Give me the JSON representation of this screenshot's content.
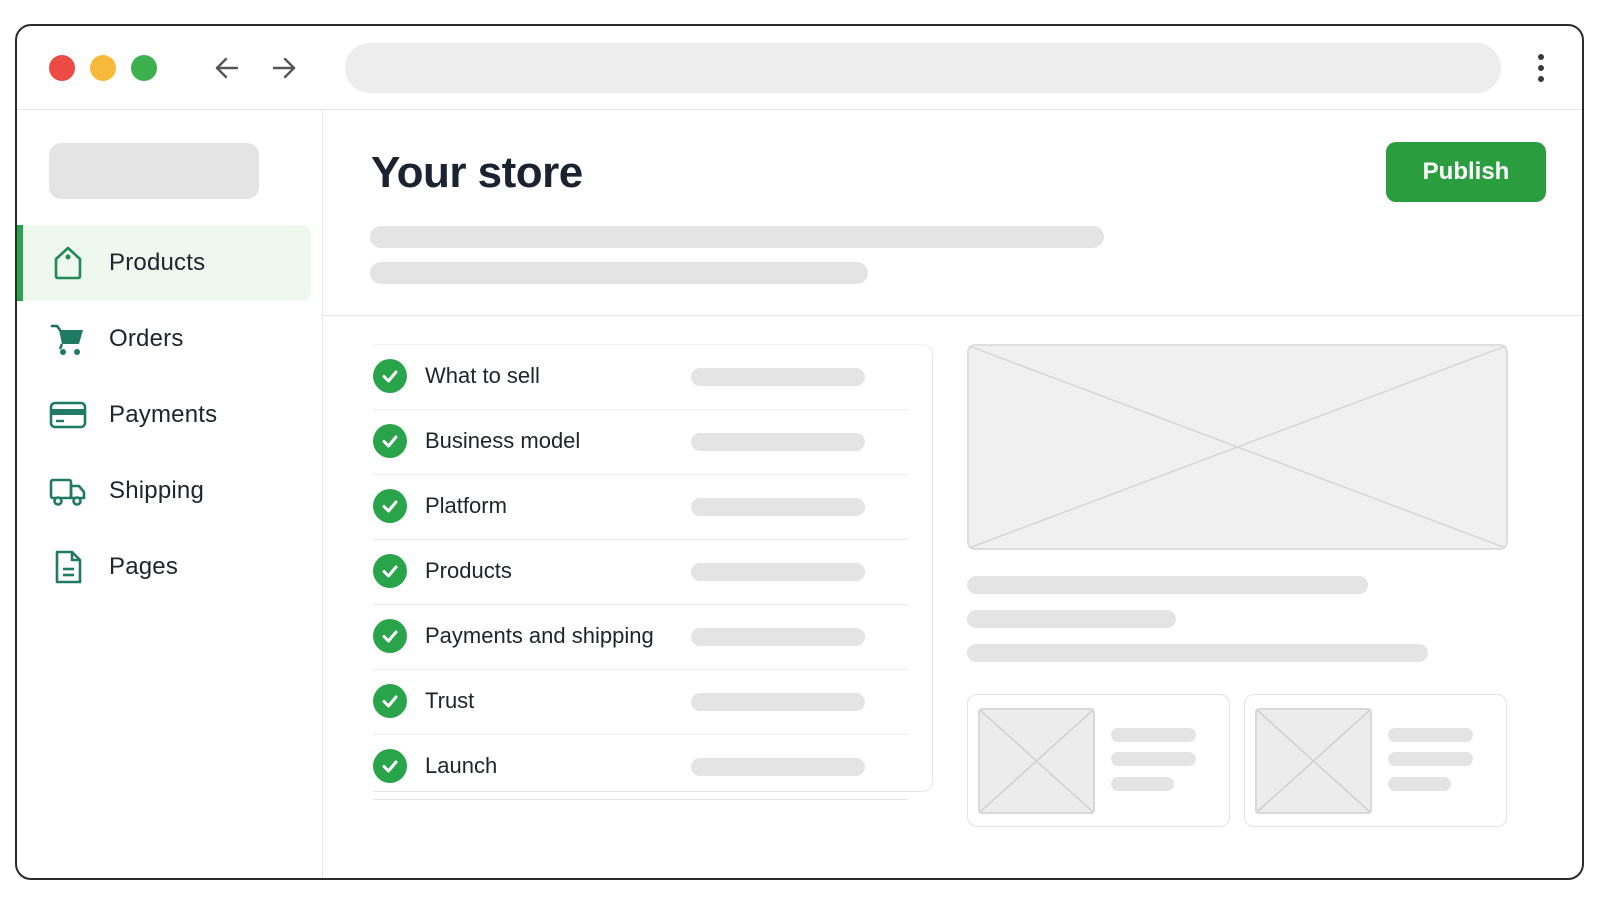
{
  "browser": {
    "controls": [
      "close",
      "minimize",
      "maximize"
    ],
    "back_icon": "arrow-left-icon",
    "forward_icon": "arrow-right-icon",
    "menu_icon": "kebab-menu-icon"
  },
  "sidebar": {
    "items": [
      {
        "label": "Products",
        "icon": "shopping-bag-icon",
        "active": true
      },
      {
        "label": "Orders",
        "icon": "cart-icon",
        "active": false
      },
      {
        "label": "Payments",
        "icon": "credit-card-icon",
        "active": false
      },
      {
        "label": "Shipping",
        "icon": "truck-icon",
        "active": false
      },
      {
        "label": "Pages",
        "icon": "document-icon",
        "active": false
      }
    ]
  },
  "header": {
    "title": "Your store",
    "publish_label": "Publish"
  },
  "checklist": {
    "items": [
      {
        "label": "What to sell",
        "done": true
      },
      {
        "label": "Business model",
        "done": true
      },
      {
        "label": "Platform",
        "done": true
      },
      {
        "label": "Products",
        "done": true
      },
      {
        "label": "Payments and shipping",
        "done": true
      },
      {
        "label": "Trust",
        "done": true
      },
      {
        "label": "Launch",
        "done": true
      }
    ]
  },
  "colors": {
    "accent": "#2a9d3f",
    "active_bg": "#eef8ef",
    "icon_teal": "#1f7a64",
    "close": "#ec4b43",
    "minimize": "#f6b93a",
    "maximize": "#3cb04d"
  }
}
